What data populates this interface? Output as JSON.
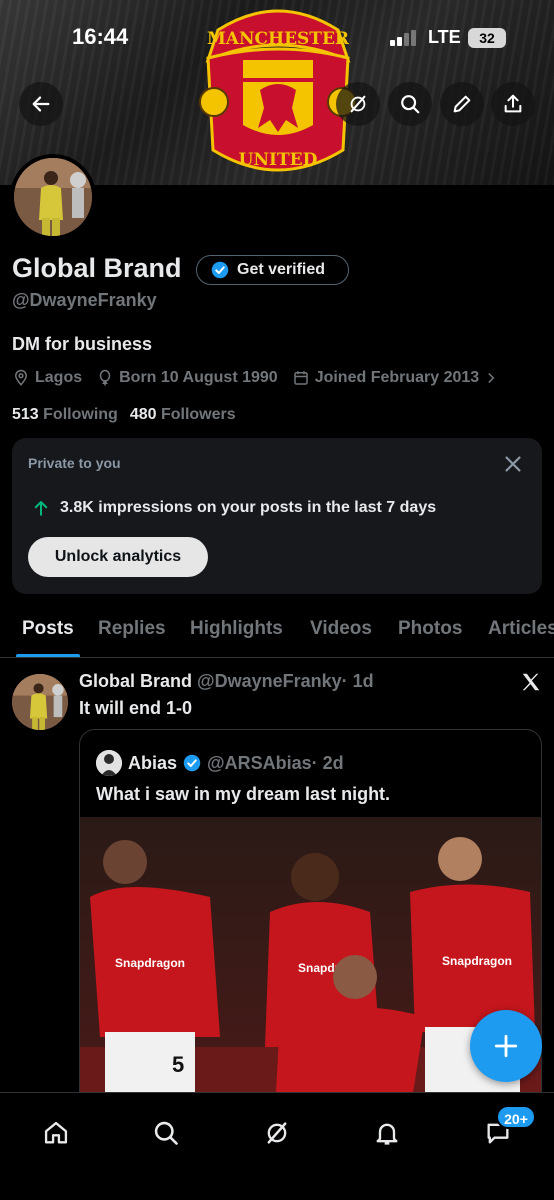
{
  "status_bar": {
    "time": "16:44",
    "network": "LTE",
    "battery": "32"
  },
  "banner": {
    "crest_text_top": "MANCHESTER",
    "crest_text_bottom": "UNITED"
  },
  "header_icons": [
    "back-arrow-icon",
    "grok-icon",
    "search-icon",
    "edit-icon",
    "share-icon"
  ],
  "profile": {
    "name": "Global Brand",
    "verify_label": "Get verified",
    "handle": "@DwayneFranky",
    "bio": "DM for business",
    "location": "Lagos",
    "born": "Born 10 August 1990",
    "joined": "Joined February 2013",
    "following_count": "513",
    "following_label": "Following",
    "followers_count": "480",
    "followers_label": "Followers"
  },
  "private_card": {
    "title": "Private to you",
    "stat": "3.8K impressions on your posts in the last 7 days",
    "button": "Unlock analytics",
    "accent": "#00ba7c"
  },
  "tabs": [
    {
      "label": "Posts",
      "active": true
    },
    {
      "label": "Replies"
    },
    {
      "label": "Highlights"
    },
    {
      "label": "Videos"
    },
    {
      "label": "Photos"
    },
    {
      "label": "Articles"
    }
  ],
  "post": {
    "name": "Global Brand",
    "handle": "@DwayneFranky",
    "time": "· 1d",
    "text": "It will end 1-0",
    "quote": {
      "name": "Abias",
      "handle": "@ARSAbias",
      "time": "· 2d",
      "text": "What i saw in my dream last night.",
      "image_sponsor": "Snapdragon",
      "shirt_number": "5"
    }
  },
  "bottom_nav": {
    "items": [
      "home-icon",
      "search-icon",
      "grok-icon",
      "notifications-icon",
      "messages-icon"
    ],
    "badge": "20+"
  },
  "colors": {
    "accent": "#1d9bf0",
    "muted": "#71767b",
    "text": "#e7e9ea",
    "card": "#16181c"
  }
}
